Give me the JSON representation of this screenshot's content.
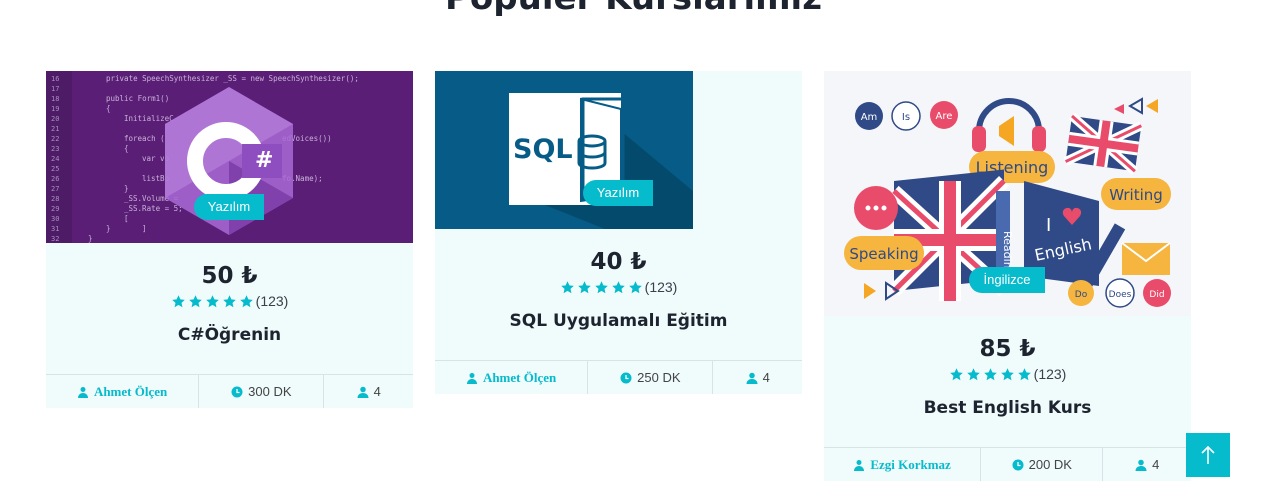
{
  "section": {
    "title": "Populer Kurslarımız"
  },
  "colors": {
    "accent": "#06bbcc",
    "card_bg": "#f0fbfc"
  },
  "courses": [
    {
      "badge": "Yazılım",
      "price": "50 ₺",
      "rating_count": "(123)",
      "stars": 5,
      "title": "C#Öğrenin",
      "instructor": "Ahmet Ölçen",
      "duration": "300 DK",
      "students": "4",
      "image": {
        "logo_text": "C#",
        "code_lines": [
          "private SpeechSynthesizer _SS = new SpeechSynthesizer();",
          "public Form1()",
          "{",
          "InitializeC",
          "foreach (",
          "edVoices())",
          "{",
          "var vo",
          "listBo",
          "fo.Name);",
          "}",
          "_SS.Volume =",
          "_SS.Rate = 5;",
          "[",
          "]",
          "}",
          "}"
        ]
      }
    },
    {
      "badge": "Yazılım",
      "price": "40 ₺",
      "rating_count": "(123)",
      "stars": 5,
      "title": "SQL Uygulamalı Eğitim",
      "instructor": "Ahmet Ölçen",
      "duration": "250 DK",
      "students": "4",
      "image": {
        "logo_text": "SQL"
      }
    },
    {
      "badge": "İngilizce",
      "price": "85 ₺",
      "rating_count": "(123)",
      "stars": 5,
      "title": "Best English Kurs",
      "instructor": "Ezgi Korkmaz",
      "duration": "200 DK",
      "students": "4",
      "image": {
        "words": [
          "Am",
          "Is",
          "Are",
          "Listening",
          "Writing",
          "Speaking",
          "I",
          "English",
          "Reading",
          "Do",
          "Does",
          "Did"
        ]
      }
    }
  ],
  "scroll_top": {
    "icon": "arrow-up-icon"
  }
}
